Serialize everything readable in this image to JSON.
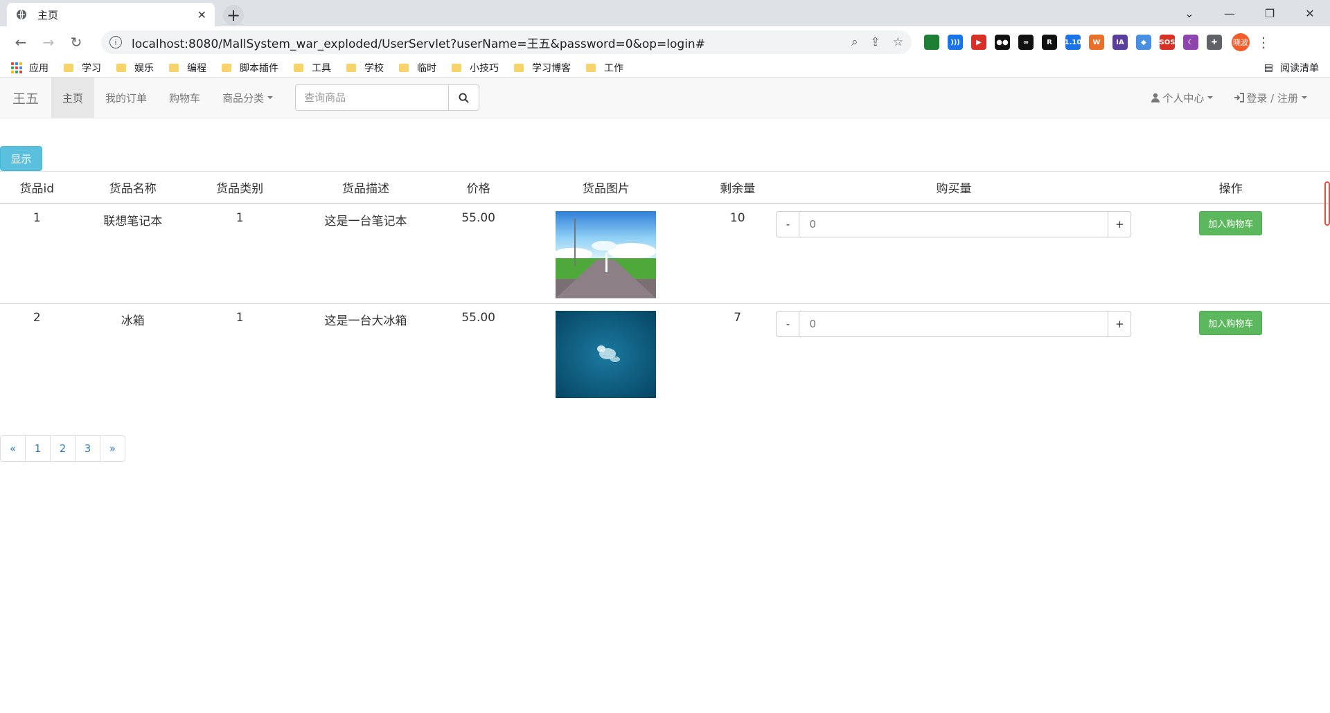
{
  "browser": {
    "tab_title": "主页",
    "url": "localhost:8080/MallSystem_war_exploded/UserServlet?userName=王五&password=0&op=login#",
    "extensions": [
      {
        "name": "green-circle-ext",
        "color": "#1e7e34",
        "label": ""
      },
      {
        "name": "wifi-ext",
        "color": "#1a73e8",
        "label": ")))"
      },
      {
        "name": "red-play-ext",
        "color": "#d93025",
        "label": "▶"
      },
      {
        "name": "black-ext",
        "color": "#111111",
        "label": "●●"
      },
      {
        "name": "owl-ext",
        "color": "#111111",
        "label": "∞"
      },
      {
        "name": "r-ext",
        "color": "#111111",
        "label": "R"
      },
      {
        "name": "badge-ext",
        "color": "#1a73e8",
        "label": "1.10"
      },
      {
        "name": "weibo-ext",
        "color": "#e8702a",
        "label": "W"
      },
      {
        "name": "ia-ext",
        "color": "#5a3e9e",
        "label": "IA"
      },
      {
        "name": "blue-diamond-ext",
        "color": "#4a90e2",
        "label": "◆"
      },
      {
        "name": "sos-ext",
        "color": "#d93025",
        "label": "SOS"
      },
      {
        "name": "moon-ext",
        "color": "#8e44ad",
        "label": "☾"
      },
      {
        "name": "puzzle-ext",
        "color": "#5f6368",
        "label": "✚"
      }
    ],
    "profile": "晓波",
    "bookmarks_apps": "应用",
    "bookmarks": [
      "学习",
      "娱乐",
      "编程",
      "脚本插件",
      "工具",
      "学校",
      "临时",
      "小技巧",
      "学习博客",
      "工作"
    ],
    "reading_list": "阅读清单"
  },
  "navbar": {
    "brand": "王五",
    "links": [
      "主页",
      "我的订单",
      "购物车"
    ],
    "category": "商品分类",
    "search_placeholder": "查询商品",
    "user_center": "个人中心",
    "login": "登录 / 注册"
  },
  "show_button": "显示",
  "table": {
    "headers": [
      "货品id",
      "货品名称",
      "货品类别",
      "货品描述",
      "价格",
      "货品图片",
      "剩余量",
      "购买量",
      "操作"
    ],
    "rows": [
      {
        "id": "1",
        "name": "联想笔记本",
        "category": "1",
        "desc": "这是一台笔记本",
        "price": "55.00",
        "image": "anime-road-landscape",
        "stock": "10",
        "qty_placeholder": "0",
        "action": "加入购物车"
      },
      {
        "id": "2",
        "name": "冰箱",
        "category": "1",
        "desc": "这是一台大冰箱",
        "price": "55.00",
        "image": "teal-cloud",
        "stock": "7",
        "qty_placeholder": "0",
        "action": "加入购物车"
      }
    ],
    "minus": "-",
    "plus": "+"
  },
  "pagination": [
    "«",
    "1",
    "2",
    "3",
    "»"
  ],
  "colors": {
    "info": "#5bc0de",
    "success": "#5cb85c",
    "link": "#337ab7"
  }
}
